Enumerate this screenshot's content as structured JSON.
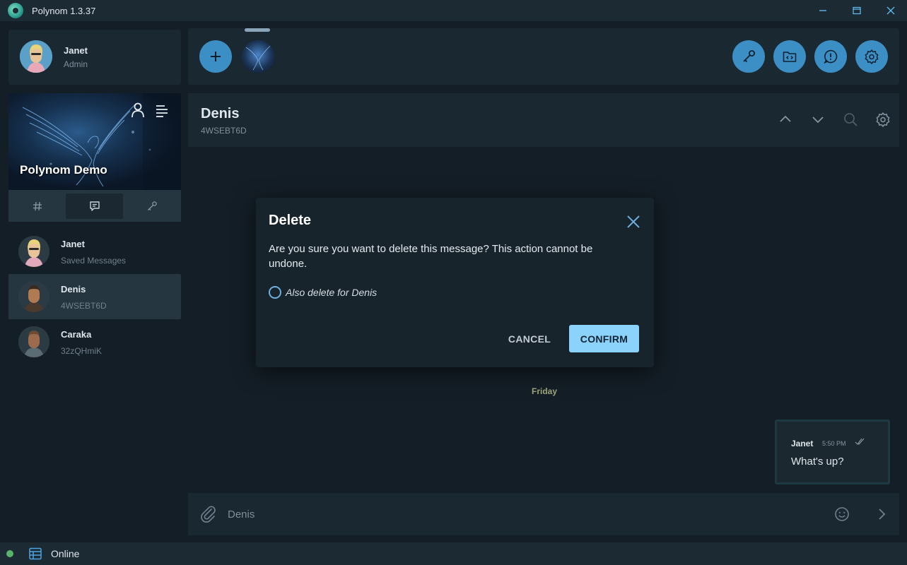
{
  "window": {
    "title": "Polynom 1.3.37",
    "controls": [
      "minimize",
      "maximize",
      "close"
    ]
  },
  "profile": {
    "name": "Janet",
    "role": "Admin"
  },
  "server": {
    "name": "Polynom Demo"
  },
  "channel_tabs": [
    {
      "icon": "hash-icon",
      "active": false
    },
    {
      "icon": "chat-bubble-icon",
      "active": true
    },
    {
      "icon": "key-icon",
      "active": false
    }
  ],
  "contacts": [
    {
      "name": "Janet",
      "subtitle": "Saved Messages",
      "selected": false
    },
    {
      "name": "Denis",
      "subtitle": "4WSEBT6D",
      "selected": true
    },
    {
      "name": "Caraka",
      "subtitle": "32zQHmiK",
      "selected": false
    }
  ],
  "chat": {
    "title": "Denis",
    "id": "4WSEBT6D",
    "day_separator": "Friday",
    "composer_placeholder": "Denis"
  },
  "message": {
    "author": "Janet",
    "time": "5:50 PM",
    "text": "What's up?"
  },
  "dialog": {
    "title": "Delete",
    "message": "Are you sure you want to delete this message? This action cannot be undone.",
    "checkbox_label": "Also delete for Denis",
    "checkbox_checked": false,
    "cancel_label": "CANCEL",
    "confirm_label": "CONFIRM"
  },
  "status": {
    "text": "Online",
    "color": "#58b46a"
  },
  "colors": {
    "accent": "#3c8fc4",
    "confirm": "#8cd3fb",
    "background": "#141e26",
    "panel": "#1a2832"
  }
}
